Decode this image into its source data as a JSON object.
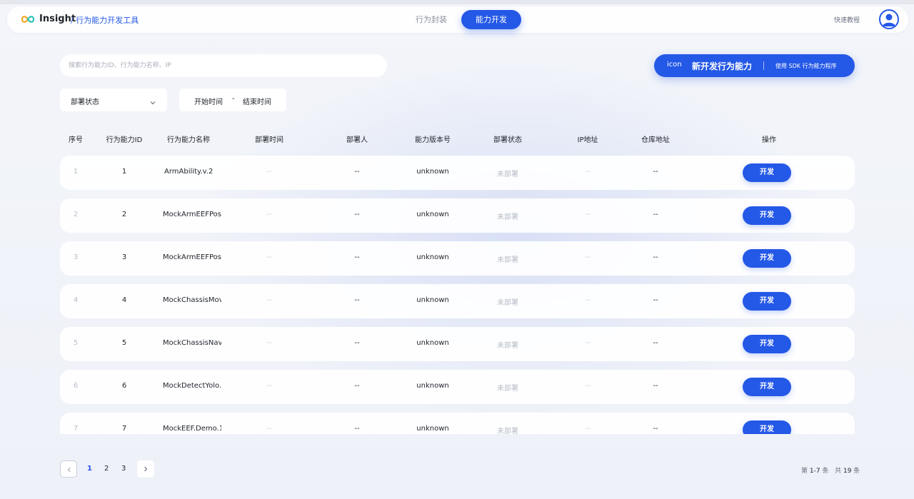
{
  "header": {
    "brand": "Insight",
    "subtitle": "/ 行为能力开发工具",
    "tabs": [
      "行为封装",
      "能力开发"
    ],
    "active_tab": "能力开发",
    "help": "快速教程"
  },
  "search": {
    "placeholder": "搜索行为能力ID、行为能力名称、IP"
  },
  "new_button": {
    "icon_label": "icon",
    "label": "新开发行为能力",
    "sdk_label": "使用 SDK 行为能力程序"
  },
  "filters": {
    "status_label": "部署状态",
    "start_label": "开始时间",
    "range_sep": "-",
    "end_label": "结束时间"
  },
  "table": {
    "columns": [
      "序号",
      "行为能力ID",
      "行为能力名称",
      "部署时间",
      "部署人",
      "能力版本号",
      "部署状态",
      "IP地址",
      "仓库地址",
      "操作"
    ],
    "rows": [
      {
        "index": "1",
        "id": "1",
        "name": "ArmAbility.v.2",
        "deploy_time": "--",
        "deployer": "--",
        "version": "unknown",
        "status": "未部署",
        "ip": "--",
        "repo": "--",
        "action": "开发"
      },
      {
        "index": "2",
        "id": "2",
        "name": "MockArmEEFPos",
        "deploy_time": "--",
        "deployer": "--",
        "version": "unknown",
        "status": "未部署",
        "ip": "--",
        "repo": "--",
        "action": "开发"
      },
      {
        "index": "3",
        "id": "3",
        "name": "MockArmEEFPos",
        "deploy_time": "--",
        "deployer": "--",
        "version": "unknown",
        "status": "未部署",
        "ip": "--",
        "repo": "--",
        "action": "开发"
      },
      {
        "index": "4",
        "id": "4",
        "name": "MockChassisMov",
        "deploy_time": "--",
        "deployer": "--",
        "version": "unknown",
        "status": "未部署",
        "ip": "--",
        "repo": "--",
        "action": "开发"
      },
      {
        "index": "5",
        "id": "5",
        "name": "MockChassisNav",
        "deploy_time": "--",
        "deployer": "--",
        "version": "unknown",
        "status": "未部署",
        "ip": "--",
        "repo": "--",
        "action": "开发"
      },
      {
        "index": "6",
        "id": "6",
        "name": "MockDetectYolo.",
        "deploy_time": "--",
        "deployer": "--",
        "version": "unknown",
        "status": "未部署",
        "ip": "--",
        "repo": "--",
        "action": "开发"
      },
      {
        "index": "7",
        "id": "7",
        "name": "MockEEF.Demo.1",
        "deploy_time": "--",
        "deployer": "--",
        "version": "unknown",
        "status": "未部署",
        "ip": "--",
        "repo": "--",
        "action": "开发"
      }
    ]
  },
  "pagination": {
    "pages": [
      "1",
      "2",
      "3"
    ],
    "current": "1",
    "range_prefix": "第",
    "range": "1-7",
    "range_suffix": "条",
    "total_prefix": "共",
    "total": "19",
    "total_suffix": "条"
  },
  "colors": {
    "accent": "#2458e6",
    "background": "#eef1f8"
  }
}
